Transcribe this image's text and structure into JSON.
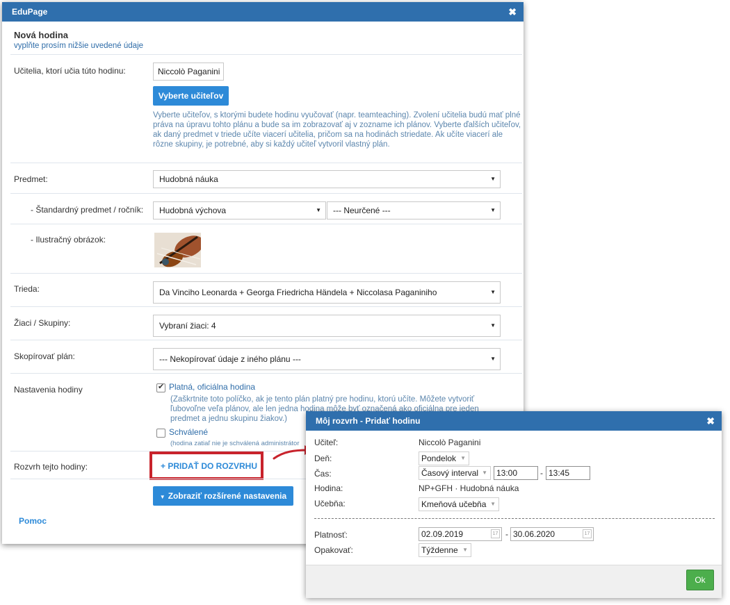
{
  "main": {
    "app_title": "EduPage",
    "close_glyph": "✖",
    "heading": "Nová hodina",
    "subheading": "vyplňte prosím nižšie uvedené údaje",
    "teachers": {
      "label": "Učitelia, ktorí učia túto hodinu:",
      "value": "Niccolò Paganini",
      "button": "Vyberte učiteľov",
      "help": "Vyberte učiteľov, s ktorými budete hodinu vyučovať (napr. teamteaching). Zvolení učitelia budú mať plné práva na úpravu tohto plánu a bude sa im zobrazovať aj v zozname ich plánov. Vyberte ďalších učiteľov, ak daný predmet v triede učíte viacerí učitelia, pričom sa na hodinách striedate. Ak učíte viacerí ale rôzne skupiny, je potrebné, aby si každý učiteľ vytvoril vlastný plán."
    },
    "subject": {
      "label": "Predmet:",
      "value": "Hudobná náuka"
    },
    "standard_subject": {
      "label": "- Štandardný predmet / ročník:",
      "value": "Hudobná výchova",
      "grade": "--- Neurčené ---"
    },
    "image": {
      "label": "- Ilustračný obrázok:"
    },
    "class": {
      "label": "Trieda:",
      "value": "Da Vinciho Leonarda + Georga Friedricha Händela + Niccolasa Paganiniho"
    },
    "students": {
      "label": "Žiaci / Skupiny:",
      "value": "Vybraní žiaci: 4"
    },
    "copy_plan": {
      "label": "Skopírovať plán:",
      "value": "--- Nekopírovať údaje z iného plánu ---"
    },
    "settings": {
      "label": "Nastavenia hodiny",
      "official_label": "Platná, oficiálna hodina",
      "official_help": "(Zaškrtnite toto políčko, ak je tento plán platný pre hodinu, ktorú učíte. Môžete vytvoriť ľubovoľne veľa plánov, ale len jedna hodina môže byť označená ako oficiálna pre jeden predmet a jednu skupinu žiakov.)",
      "approved_label": "Schválené",
      "approved_help": "(hodina zatiaľ nie je schválená administrátor"
    },
    "schedule": {
      "label": "Rozvrh tejto hodiny:",
      "button": "+ PRIDAŤ DO ROZVRHU"
    },
    "advanced_button": "Zobraziť rozšírené nastavenia",
    "help_link": "Pomoc"
  },
  "popup": {
    "title": "Môj rozvrh - Pridať hodinu",
    "close_glyph": "✖",
    "teacher_label": "Učiteľ:",
    "teacher_value": "Niccolò Paganini",
    "day_label": "Deň:",
    "day_value": "Pondelok",
    "time_label": "Čas:",
    "time_mode": "Časový interval",
    "time_from": "13:00",
    "time_dash": "-",
    "time_to": "13:45",
    "lesson_label": "Hodina:",
    "lesson_value": "NP+GFH · Hudobná náuka",
    "room_label": "Učebňa:",
    "room_value": "Kmeňová učebňa",
    "validity_label": "Platnosť:",
    "validity_from": "02.09.2019",
    "validity_dash": "-",
    "validity_to": "30.06.2020",
    "repeat_label": "Opakovať:",
    "repeat_value": "Týždenne",
    "ok_button": "Ok"
  },
  "colors": {
    "titlebar": "#2f6fad",
    "button": "#2d8ad8",
    "highlight": "#c8232c",
    "ok_button": "#4cae4c",
    "help_text": "#5c86ad"
  }
}
